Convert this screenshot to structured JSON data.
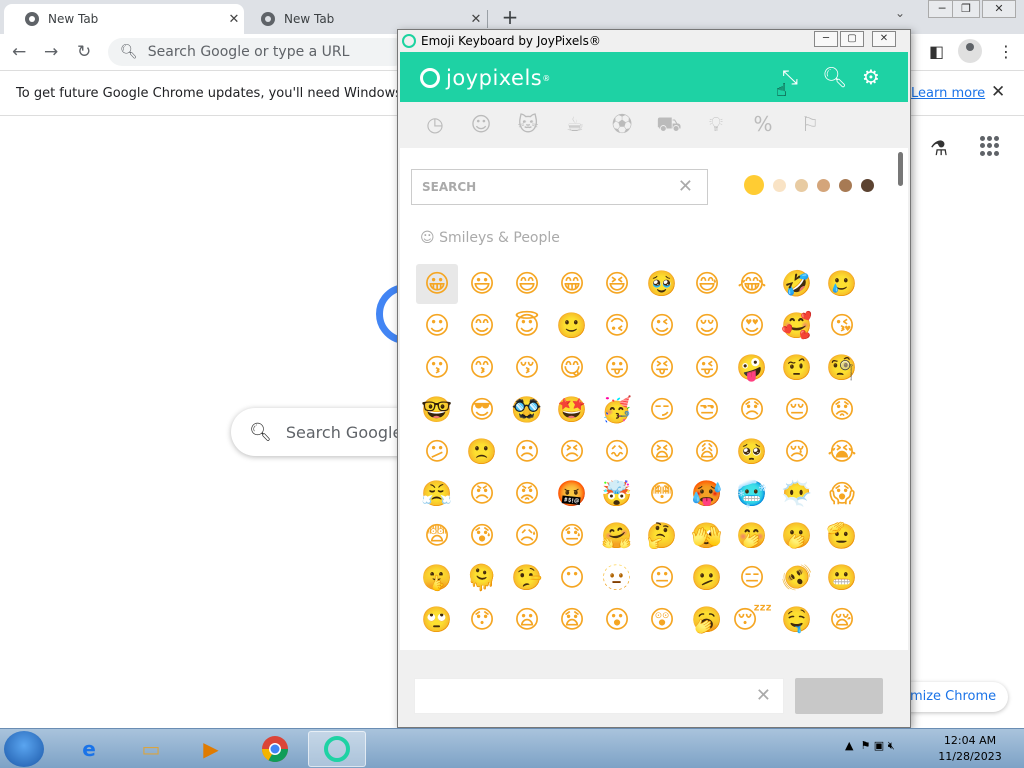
{
  "browser": {
    "tabs": [
      {
        "title": "New Tab",
        "active": true
      },
      {
        "title": "New Tab",
        "active": false
      }
    ],
    "omnibox_placeholder": "Search Google or type a URL",
    "infobar": {
      "message": "To get future Google Chrome updates, you'll need Windows 10 or",
      "link": "Learn more"
    },
    "search_placeholder": "Search Google o",
    "customize_label": "omize Chrome"
  },
  "emoji_keyboard": {
    "window_title": "Emoji Keyboard by JoyPixels®",
    "brand": "joypixels",
    "brand_mark": "®",
    "brand_color": "#1ed2a4",
    "search_placeholder": "SEARCH",
    "section_icon": "☺",
    "section_title": "Smileys & People",
    "categories": [
      "recent-icon",
      "smiley-icon",
      "animal-icon",
      "food-icon",
      "sport-icon",
      "car-icon",
      "lightbulb-icon",
      "symbols-icon",
      "flag-icon"
    ],
    "skin_tones": [
      "#ffcc33",
      "#f9e3c5",
      "#e8cba2",
      "#d4a57a",
      "#a77a54",
      "#5c4331"
    ],
    "emojis": [
      "😀",
      "😃",
      "😄",
      "😁",
      "😆",
      "🥹",
      "😅",
      "😂",
      "🤣",
      "🥲",
      "☺",
      "😊",
      "😇",
      "🙂",
      "🙃",
      "😉",
      "😌",
      "😍",
      "🥰",
      "😘",
      "😗",
      "😙",
      "😚",
      "😋",
      "😛",
      "😝",
      "😜",
      "🤪",
      "🤨",
      "🧐",
      "🤓",
      "😎",
      "🥸",
      "🤩",
      "🥳",
      "😏",
      "😒",
      "😞",
      "😔",
      "😟",
      "😕",
      "🙁",
      "☹",
      "😣",
      "😖",
      "😫",
      "😩",
      "🥺",
      "😢",
      "😭",
      "😤",
      "😠",
      "😡",
      "🤬",
      "🤯",
      "😳",
      "🥵",
      "🥶",
      "😶‍🌫️",
      "😱",
      "😨",
      "😰",
      "😥",
      "😓",
      "🤗",
      "🤔",
      "🫣",
      "🤭",
      "🫢",
      "🫡",
      "🤫",
      "🫠",
      "🤥",
      "😶",
      "🫥",
      "😐",
      "🫤",
      "😑",
      "🫨",
      "😬",
      "🙄",
      "😯",
      "😦",
      "😧",
      "😮",
      "😲",
      "🥱",
      "😴",
      "🤤",
      "😪"
    ]
  },
  "taskbar": {
    "time": "12:04 AM",
    "date": "11/28/2023"
  }
}
